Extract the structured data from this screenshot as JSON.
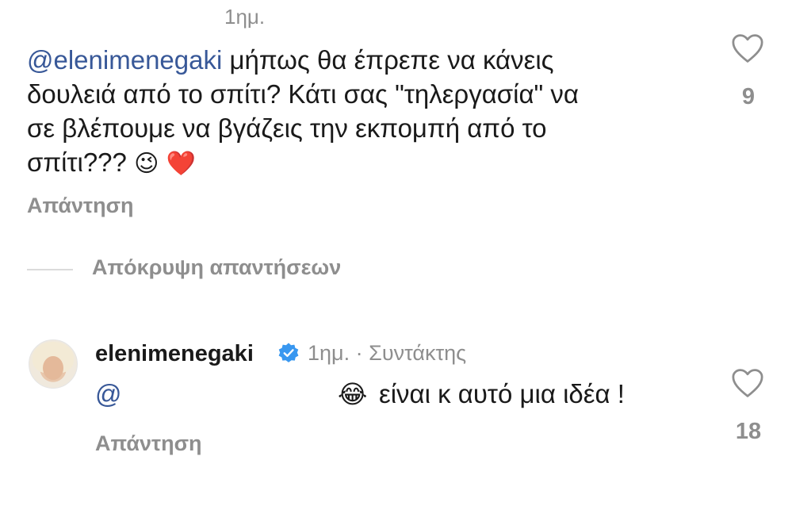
{
  "comment1": {
    "time": "1ημ.",
    "mention": "@elenimenegaki",
    "text_line1_rest": " μήπως θα έπρεπε να κάνεις",
    "text_line2": "δουλειά από το σπίτι? Κάτι σας \"τηλεργασία\" να",
    "text_line3": "σε βλέπουμε να βγάζεις την εκπομπή από το",
    "text_line4": "σπίτι???",
    "emoji1": "😉",
    "emoji2": "❤️",
    "reply_label": "Απάντηση",
    "likes": "9"
  },
  "hide_replies_label": "Απόκρυψη απαντήσεων",
  "reply": {
    "username": "elenimenegaki",
    "time": "1ημ.",
    "separator": "·",
    "role": "Συντάκτης",
    "mention": "@",
    "emoji": "😂",
    "text": "είναι κ αυτό μια ιδέα !",
    "reply_label": "Απάντηση",
    "likes": "18"
  },
  "colors": {
    "mention": "#385898",
    "muted": "#8e8e8e",
    "verified": "#3897f0"
  }
}
